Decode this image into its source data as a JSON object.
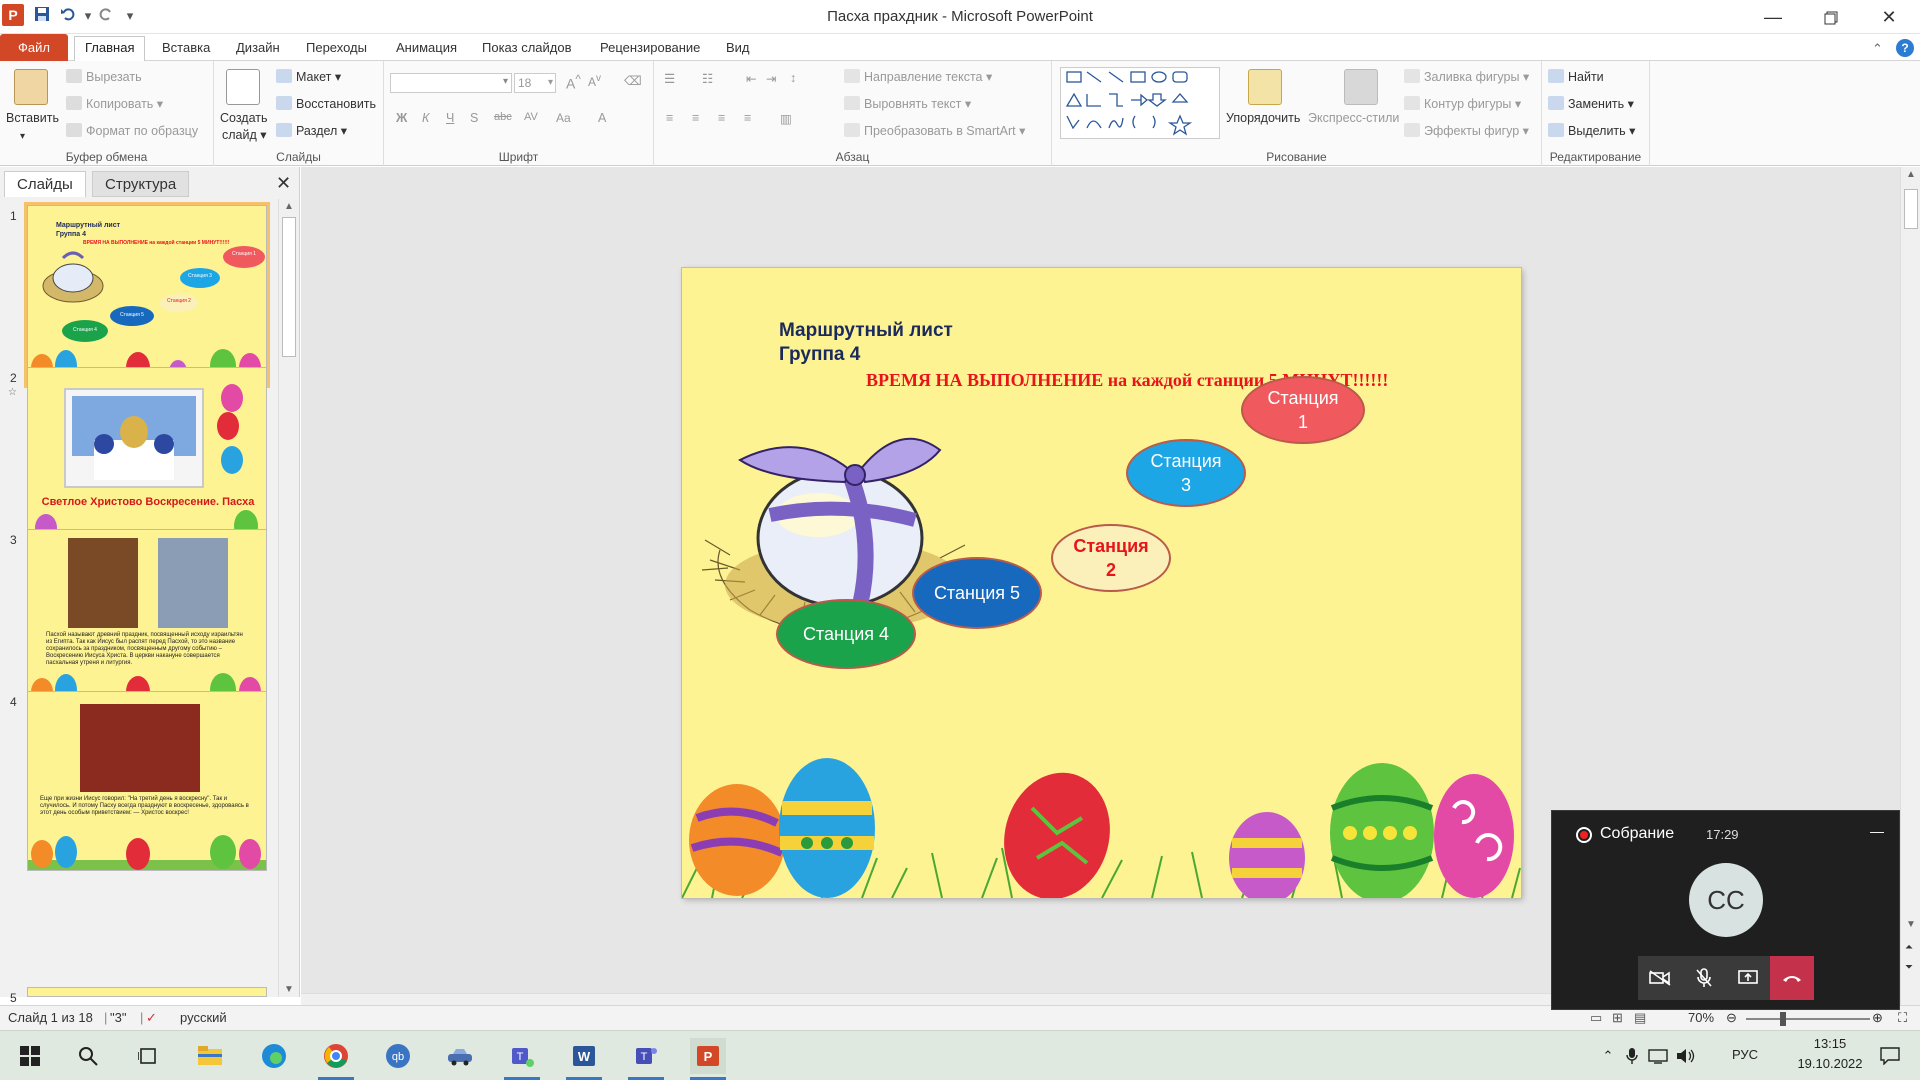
{
  "window": {
    "title": "Пасха прахдник  -  Microsoft PowerPoint",
    "app_icon": "P",
    "qat": [
      "save-icon",
      "undo-icon",
      "redo-icon",
      "customize-icon"
    ],
    "controls": [
      "minimize-icon",
      "restore-icon",
      "close-icon"
    ]
  },
  "ribbon_tabs": {
    "file": "Файл",
    "items": [
      "Главная",
      "Вставка",
      "Дизайн",
      "Переходы",
      "Анимация",
      "Показ слайдов",
      "Рецензирование",
      "Вид"
    ],
    "active": "Главная"
  },
  "ribbon": {
    "clipboard": {
      "label": "Буфер обмена",
      "paste": "Вставить",
      "cut": "Вырезать",
      "copy": "Копировать",
      "format_painter": "Формат по образцу"
    },
    "slides": {
      "label": "Слайды",
      "new_slide_1": "Создать",
      "new_slide_2": "слайд",
      "layout": "Макет",
      "reset": "Восстановить",
      "section": "Раздел"
    },
    "font": {
      "label": "Шрифт",
      "name": "",
      "size": "18"
    },
    "paragraph": {
      "label": "Абзац",
      "text_direction": "Направление текста",
      "align_text": "Выровнять текст",
      "smartart": "Преобразовать в SmartArt"
    },
    "drawing": {
      "label": "Рисование",
      "arrange": "Упорядочить",
      "quick_styles": "Экспресс-стили",
      "shape_fill": "Заливка фигуры",
      "shape_outline": "Контур фигуры",
      "shape_effects": "Эффекты фигур"
    },
    "editing": {
      "label": "Редактирование",
      "find": "Найти",
      "replace": "Заменить",
      "select": "Выделить"
    }
  },
  "left_panel": {
    "tabs": [
      "Слайды",
      "Структура"
    ],
    "slides": [
      {
        "num": "1",
        "title": "Маршрутный лист",
        "subtitle": "Группа 4",
        "caption": "ВРЕМЯ НА ВЫПОЛНЕНИЕ на каждой станции 5 МИНУТ!!!!!!",
        "stations": [
          "Станция 1",
          "Станция 3",
          "Станция 2",
          "Станция 5",
          "Станция 4"
        ]
      },
      {
        "num": "2",
        "caption": "Светлое Христово Воскресение. Пасха"
      },
      {
        "num": "3",
        "caption": "Пасхой называют древний праздник, посвященный исходу израильтян из Египта. Так как Иисус был распят перед Пасхой, то это название сохранилось за праздником, посвященным другому событию – Воскресению Иисуса Христа. В церкви накануне совершается пасхальная утреня и литургия."
      },
      {
        "num": "4",
        "caption": "Еще при жизни Иисус говорил: \"На третий день я воскресну\". Так и случилось. И потому Пасху всегда празднуют в воскресенье, здороваясь в этот день особым приветствием: — Христос воскрес!"
      },
      {
        "num": "5"
      }
    ]
  },
  "slide": {
    "title": "Маршрутный лист",
    "subtitle": "Группа 4",
    "time_note": "ВРЕМЯ НА ВЫПОЛНЕНИЕ на каждой станции 5 МИНУТ!!!!!!",
    "stations": [
      {
        "line1": "Станция",
        "line2": "1",
        "color": "#f05a5f",
        "text_color": "#ffffff"
      },
      {
        "line1": "Станция",
        "line2": "3",
        "color": "#1ca6e6",
        "text_color": "#ffffff"
      },
      {
        "line1": "Станция",
        "line2": "2",
        "color": "#fbf0b9",
        "text_color": "#e8141c"
      },
      {
        "line1": "Станция 5",
        "line2": "",
        "color": "#1769bd",
        "text_color": "#ffffff"
      },
      {
        "line1": "Станция 4",
        "line2": "",
        "color": "#1aa34a",
        "text_color": "#ffffff"
      }
    ]
  },
  "status_bar": {
    "slide_info": "Слайд 1 из 18",
    "theme": "\"3\"",
    "language": "русский",
    "zoom": "70%"
  },
  "meeting": {
    "title": "Собрание",
    "time": "17:29",
    "initials": "СС",
    "buttons": [
      "camera-off-icon",
      "mic-off-icon",
      "share-screen-icon",
      "hang-up-icon"
    ]
  },
  "taskbar": {
    "lang": "РУС",
    "time": "13:15",
    "date": "19.10.2022"
  }
}
